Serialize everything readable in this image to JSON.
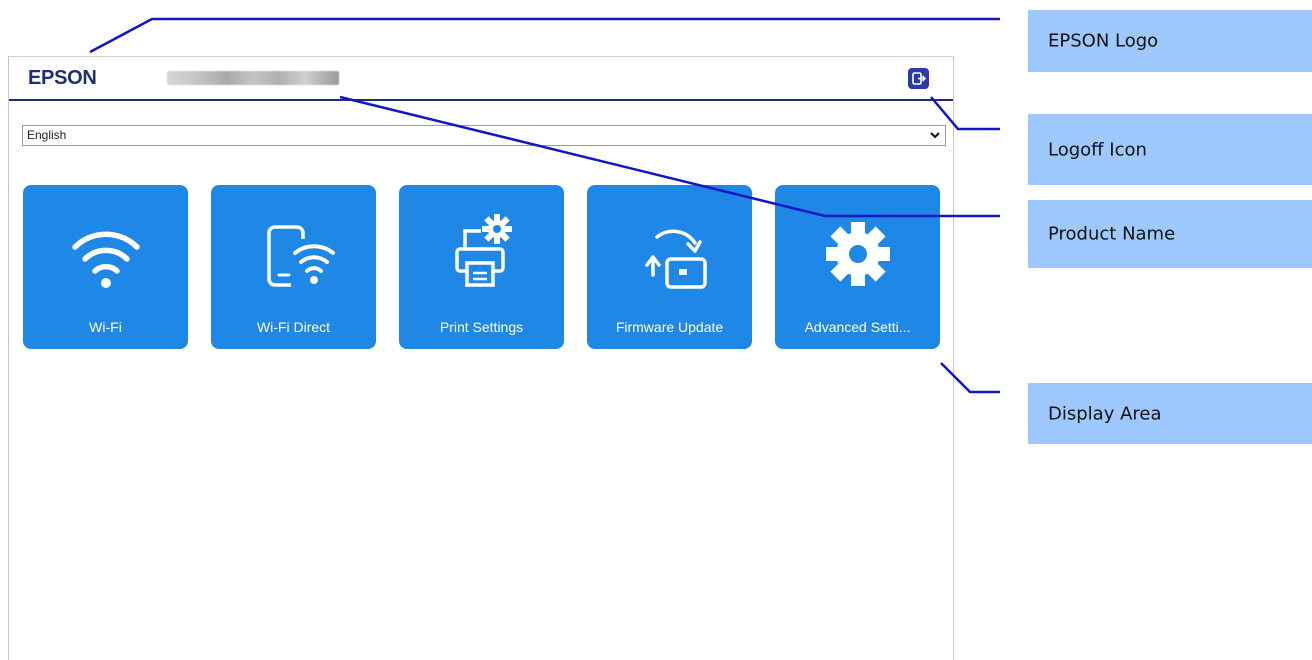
{
  "header": {
    "logo_text": "EPSON",
    "product_name": "",
    "logoff_icon": "logoff-icon"
  },
  "language": {
    "selected": "English"
  },
  "tiles": [
    {
      "label": "Wi-Fi",
      "icon": "wifi-icon"
    },
    {
      "label": "Wi-Fi Direct",
      "icon": "wifi-direct-icon"
    },
    {
      "label": "Print Settings",
      "icon": "printer-settings-icon"
    },
    {
      "label": "Firmware Update",
      "icon": "firmware-update-icon"
    },
    {
      "label": "Advanced Setti...",
      "icon": "gear-icon"
    }
  ],
  "callouts": {
    "epson_logo": "EPSON Logo",
    "logoff_icon": "Logoff Icon",
    "product_name": "Product Name",
    "display_area": "Display Area"
  },
  "colors": {
    "tile_blue": "#1f87e5",
    "header_rule": "#1e2e78",
    "logoff_bg": "#2b3aa6",
    "callout_bg": "#9ec9ff",
    "leader_line": "#1414c8"
  }
}
